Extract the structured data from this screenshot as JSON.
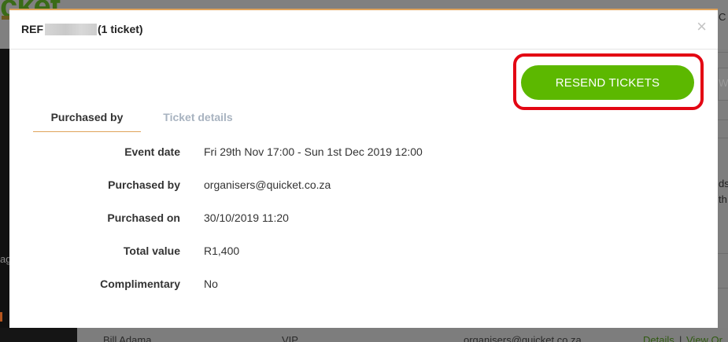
{
  "background": {
    "logo_text": "cket",
    "sidebar_fragment": "ag",
    "right_fragments": [
      "C",
      "W",
      "ds",
      "th"
    ],
    "table_row": {
      "name": "Bill Adama",
      "ticket_type": "VIP",
      "email": "organisers@quicket.co.za",
      "link_details": "Details",
      "link_separator": "|",
      "link_view": "View Or"
    }
  },
  "modal": {
    "title_prefix": "REF",
    "title_suffix": "(1 ticket)",
    "close_label": "×",
    "resend_label": "RESEND TICKETS",
    "tabs": [
      {
        "label": "Purchased by",
        "active": true
      },
      {
        "label": "Ticket details",
        "active": false
      }
    ],
    "details": [
      {
        "label": "Event date",
        "value": "Fri 29th Nov 17:00 - Sun 1st Dec 2019 12:00"
      },
      {
        "label": "Purchased by",
        "value": "organisers@quicket.co.za"
      },
      {
        "label": "Purchased on",
        "value": "30/10/2019 11:20"
      },
      {
        "label": "Total value",
        "value": "R1,400"
      },
      {
        "label": "Complimentary",
        "value": "No"
      }
    ]
  },
  "colors": {
    "accent_orange": "#e0a35a",
    "button_green": "#5cb800",
    "highlight_red": "#e30613",
    "inactive_tab": "#a8b3c0"
  }
}
